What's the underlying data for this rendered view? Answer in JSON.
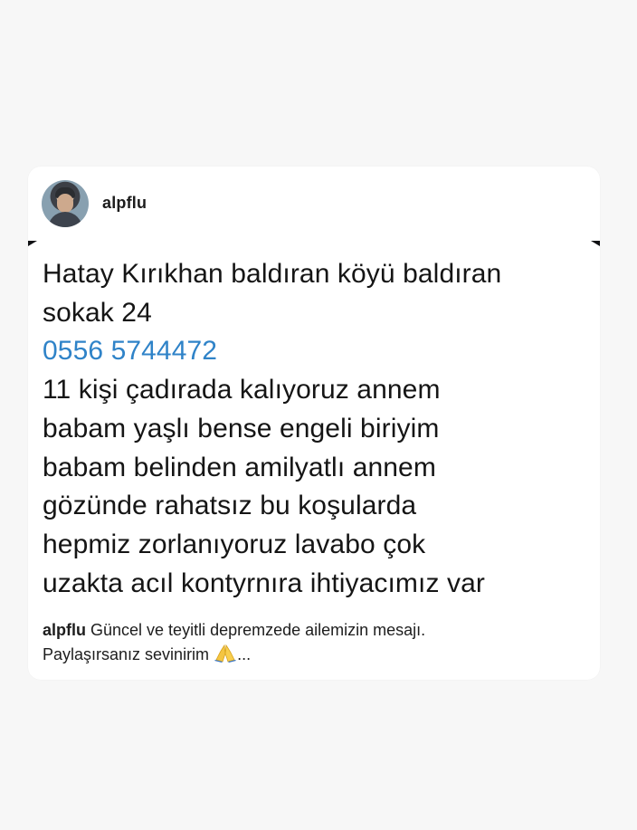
{
  "post": {
    "username": "alpflu",
    "message_lines": [
      "Hatay Kırıkhan baldıran köyü baldıran",
      "sokak 24",
      "0556 5744472",
      "11 kişi çadırada kalıyoruz annem",
      "babam yaşlı bense engeli biriyim",
      "babam belinden amilyatlı annem",
      "gözünde rahatsız bu koşularda",
      "hepmiz zorlanıyoruz lavabo çok",
      "uzakta acıl kontyrnıra ihtiyacımız var"
    ],
    "caption_line_1": "Güncel ve teyitli depremzede ailemizin mesajı.",
    "caption_line_2_prefix": "Paylaşırsanız sevinirim",
    "caption_more": "..."
  },
  "icons": {
    "avatar": "profile-photo",
    "pray": "folded-hands-emoji"
  },
  "colors": {
    "background": "#f7f7f7",
    "card": "#ffffff",
    "text": "#151515",
    "phone_link": "#2f83c8"
  }
}
